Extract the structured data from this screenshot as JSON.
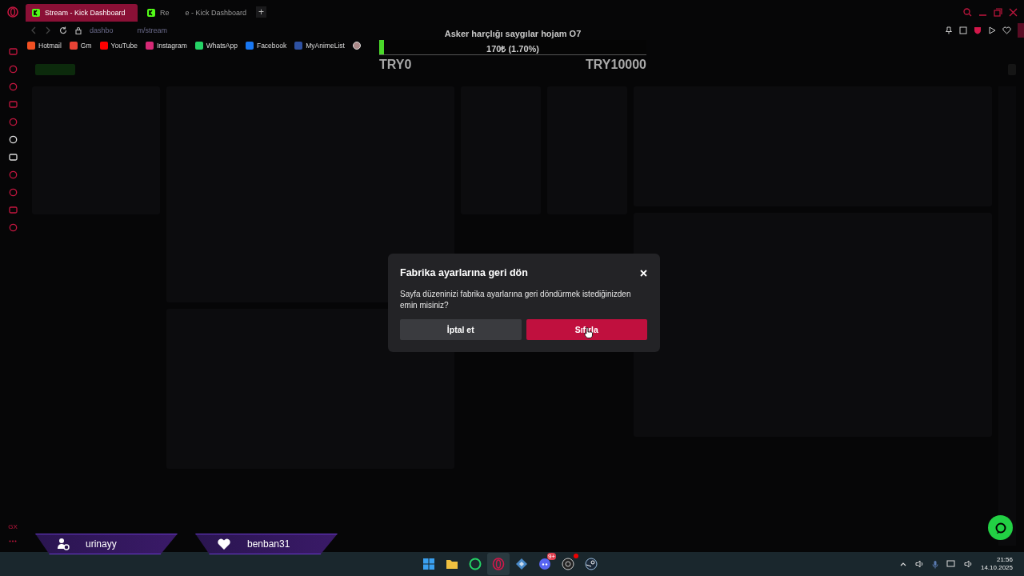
{
  "browser": {
    "tabs": [
      {
        "parts": [
          "Stream - Kick Dashboard"
        ],
        "selected": true
      },
      {
        "parts": [
          "Re",
          "e - Kick Dashboard"
        ],
        "selected": false
      }
    ],
    "new_tab": "+",
    "address": {
      "parts": [
        "dashbo",
        "m/stream"
      ]
    },
    "bookmarks": [
      {
        "label": "Hotmail"
      },
      {
        "label": "Gm"
      },
      {
        "label": "YouTube"
      },
      {
        "label": "Instagram"
      },
      {
        "label": "WhatsApp"
      },
      {
        "label": "Facebook"
      },
      {
        "label": "MyAnimeList"
      }
    ],
    "sidebar_badge": "GX"
  },
  "donation_goal": {
    "title": "Asker harçlığı saygılar hojam O7",
    "level": 0.017,
    "amount": "170₺ (1.70%)",
    "min": "TRY0",
    "max": "TRY10000"
  },
  "alerts": [
    {
      "kind": "follower",
      "name": "urinayy"
    },
    {
      "kind": "subscriber",
      "name": "benban31"
    }
  ],
  "dialog": {
    "title": "Fabrika ayarlarına geri dön",
    "message": "Sayfa düzeninizi fabrika ayarlarına geri döndürmek istediğinizden emin misiniz?",
    "buttons": [
      {
        "label": "İptal et",
        "kind": "secondary"
      },
      {
        "label": "Sıfırla",
        "kind": "danger"
      }
    ]
  },
  "taskbar": {
    "apps": [
      {
        "kind": "start",
        "selected": false
      },
      {
        "kind": "folder",
        "selected": false
      },
      {
        "kind": "whatsapp",
        "selected": false
      },
      {
        "kind": "opera",
        "selected": true
      },
      {
        "kind": "app",
        "selected": false
      },
      {
        "kind": "discord",
        "selected": false
      },
      {
        "kind": "obs",
        "selected": false
      },
      {
        "kind": "steam",
        "selected": false
      }
    ],
    "discord_badge": "9+",
    "time": "21:56",
    "date": "14.10.2025"
  }
}
